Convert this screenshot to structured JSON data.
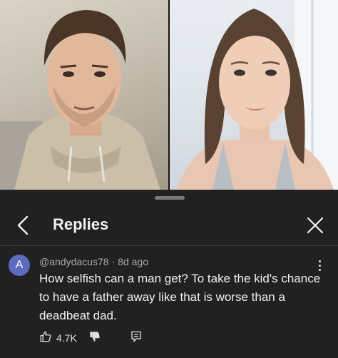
{
  "sheet": {
    "title": "Replies"
  },
  "comment": {
    "avatar_letter": "A",
    "author": "@andydacus78",
    "separator": "·",
    "time": "8d ago",
    "text": "How selfish can a man get? To take the kid's chance to have a father away like that is worse than a deadbeat dad.",
    "likes": "4.7K"
  },
  "icons": {
    "back": "chevron-left-icon",
    "close": "close-icon",
    "more": "more-vert-icon",
    "like": "thumbs-up-icon",
    "dislike": "thumbs-down-icon",
    "reply": "reply-comment-icon"
  },
  "colors": {
    "sheet_bg": "#212121",
    "page_bg": "#0f0f0f",
    "avatar_bg": "#5c6bc0",
    "meta_text": "#aaaaaa"
  }
}
